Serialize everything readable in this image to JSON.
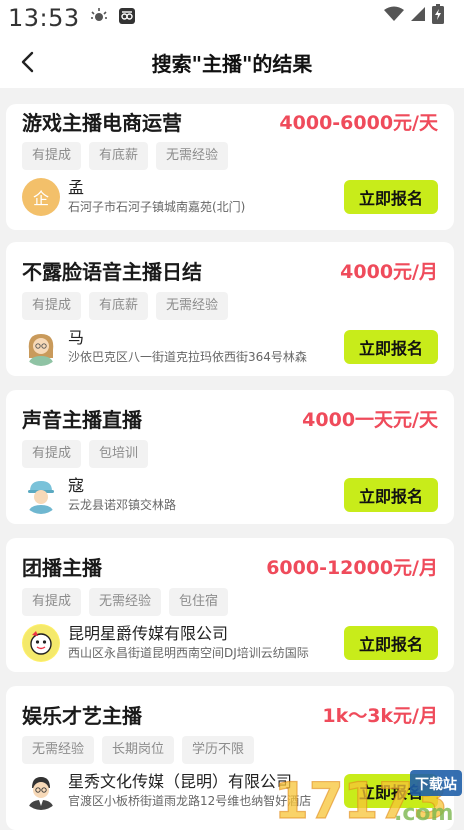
{
  "status_bar": {
    "time": "13:53"
  },
  "header": {
    "title": "搜索\"主播\"的结果"
  },
  "jobs": [
    {
      "title": "游戏主播电商运营",
      "salary": "4000-6000元/天",
      "tags": [
        "有提成",
        "有底薪",
        "无需经验"
      ],
      "poster_name": "孟",
      "address": "石河子市石河子镇城南嘉苑(北门)",
      "avatar_text": "企",
      "apply_label": "立即报名"
    },
    {
      "title": "不露脸语音主播日结",
      "salary": "4000元/月",
      "tags": [
        "有提成",
        "有底薪",
        "无需经验"
      ],
      "poster_name": "马",
      "address": "沙依巴克区八一街道克拉玛依西街364号林森",
      "apply_label": "立即报名"
    },
    {
      "title": "声音主播直播",
      "salary": "4000一天元/天",
      "tags": [
        "有提成",
        "包培训"
      ],
      "poster_name": "寇",
      "address": "云龙县诺邓镇交林路",
      "apply_label": "立即报名"
    },
    {
      "title": "团播主播",
      "salary": "6000-12000元/月",
      "tags": [
        "有提成",
        "无需经验",
        "包住宿"
      ],
      "poster_name": "昆明星爵传媒有限公司",
      "address": "西山区永昌街道昆明西南空间DJ培训云纺国际",
      "apply_label": "立即报名"
    },
    {
      "title": "娱乐才艺主播",
      "salary": "1k～3k元/月",
      "tags": [
        "无需经验",
        "长期岗位",
        "学历不限"
      ],
      "poster_name": "星秀文化传媒（昆明）有限公司",
      "address": "官渡区小板桥街道雨龙路12号维也纳智好酒店",
      "apply_label": "立即报名"
    }
  ],
  "watermark": {
    "site": "17173",
    "suffix": ".com",
    "badge": "下载站"
  },
  "colors": {
    "accent_button": "#c8ec1a",
    "salary": "#ef4b5b",
    "background": "#f2f2f2"
  }
}
